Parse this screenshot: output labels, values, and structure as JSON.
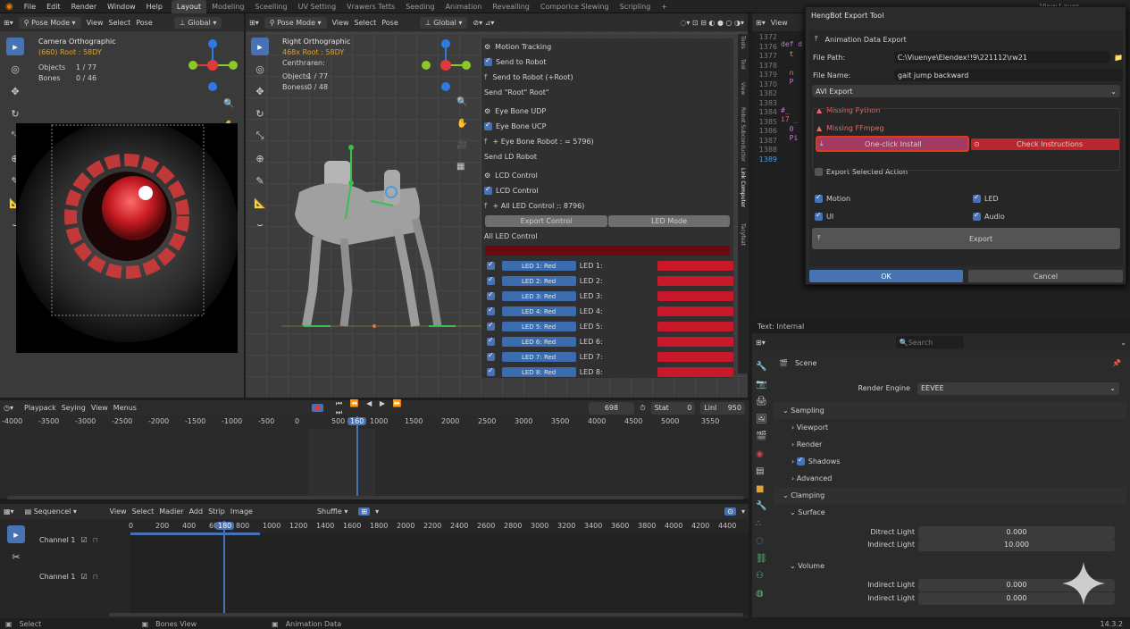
{
  "menu": [
    "File",
    "Edit",
    "Render",
    "Window",
    "Help"
  ],
  "workspaces": [
    "Layout",
    "Modeling",
    "Sceelling",
    "UV Setting",
    "Vrawers Tetts",
    "Seeding",
    "Animation",
    "Revealling",
    "Comporice Slewing",
    "Scripling"
  ],
  "topright": {
    "view_layer": "View Layer"
  },
  "viewport_left": {
    "mode": "Pose Mode",
    "menus": [
      "View",
      "Select",
      "Pose"
    ],
    "transform": "Global",
    "title": "Camera Orthographic",
    "subtitle": "(660) Root : 58DY",
    "objects_label": "Objects",
    "objects_value": "1 / 77",
    "bones_label": "Bones",
    "bones_value": "0 / 46"
  },
  "viewport_right": {
    "mode": "Pose Mode",
    "menus": [
      "View",
      "Select",
      "Pose"
    ],
    "transform": "Global",
    "title": "Right Orthographic",
    "subtitle": "468x Root : 58DY",
    "name": "Centhraren:",
    "objects_label": "Objects",
    "objects_value": "1 / 77",
    "bones_label": "Boness",
    "bones_value": "0 / 48"
  },
  "npanel": {
    "items": [
      {
        "label": "Motion Tracking",
        "type": "header"
      },
      {
        "label": "Send to Robot",
        "type": "check"
      },
      {
        "label": "Send to Robot (+Root)",
        "type": "arrow"
      },
      {
        "label": "Send \"Root\" Root\"",
        "type": "plain"
      },
      {
        "label": "Eye Bone UDP",
        "type": "header"
      },
      {
        "label": "Eye Bone UCP",
        "type": "check"
      },
      {
        "label": "+ Eye Bone Robot : = 5796)",
        "type": "arrow"
      },
      {
        "label": "Send LD Robot",
        "type": "plain"
      },
      {
        "label": "LCD Control",
        "type": "header"
      },
      {
        "label": "LCD Control",
        "type": "check"
      },
      {
        "label": "+ All LED Control :: 8796)",
        "type": "arrow"
      }
    ],
    "export_control": "Export Control",
    "led_mode": "LED Mode",
    "all_led": "All LED Control",
    "leds": [
      {
        "btn": "LED 1: Red",
        "label": "LED 1:"
      },
      {
        "btn": "LED 2: Red",
        "label": "LED 2:"
      },
      {
        "btn": "LED 3: Red",
        "label": "LED 3:"
      },
      {
        "btn": "LED 4: Red",
        "label": "LED 4:"
      },
      {
        "btn": "LED 5: Red",
        "label": "LED 5:"
      },
      {
        "btn": "LED 6: Red",
        "label": "LED 6:"
      },
      {
        "btn": "LED 7: Red",
        "label": "LED 7:"
      },
      {
        "btn": "LED 8: Red",
        "label": "LED 8:"
      }
    ],
    "tabs": [
      "Tools",
      "Tool",
      "View",
      "Robot Subconductor",
      "Link Computer",
      "Tacyfeat"
    ]
  },
  "code": {
    "view": "View",
    "lines": [
      "1372",
      "1376",
      "1377",
      "1378",
      "1379",
      "1370",
      "1382",
      "1383",
      "1384",
      "1385",
      "1386",
      "1387",
      "1388",
      "1389"
    ]
  },
  "dialog": {
    "title": "HengBot Export Tool",
    "section": "Animation Data Export",
    "file_path_label": "File Path:",
    "file_path": "C:\\Viuenye\\Elendex!!9\\221112\\rw21",
    "file_name_label": "File Name:",
    "file_name": "gait jump backward",
    "format": "AVI Export",
    "warn1": "Missing Python",
    "warn2": "Missing FFmpeg",
    "install": "One-click Install",
    "instructions": "Check Instructions",
    "export_selected": "Export Selected Action",
    "opt_motion": "Motion",
    "opt_led": "LED",
    "opt_ui": "UI",
    "opt_audio": "Audio",
    "export": "Export",
    "ok": "OK",
    "cancel": "Cancel"
  },
  "text_internal": "Text: Internal",
  "properties": {
    "search": "Search",
    "scene": "Scene",
    "render_engine_label": "Render Engine",
    "render_engine": "EEVEE",
    "sampling": "Sampling",
    "viewport": "Viewport",
    "render": "Render",
    "shadows": "Shadows",
    "advanced": "Advanced",
    "clamping": "Clamping",
    "surface": "Surface",
    "direct_label": "Ditrect Light",
    "direct_value": "0.000",
    "indirect_label": "Indirect Light",
    "indirect_value": "10.000",
    "volume": "Volume",
    "vol_ind1_label": "Indirect Light",
    "vol_ind1_value": "0.000",
    "vol_ind2_label": "Indirect Light",
    "vol_ind2_value": "0.000"
  },
  "timeline": {
    "menus": [
      "Playpack",
      "Seying",
      "View",
      "Menus"
    ],
    "frame": "698",
    "stat_label": "Stat",
    "stat_value": "0",
    "end_label": "Linl",
    "end_value": "950",
    "current": "160",
    "ticks": [
      "-4000",
      "-3500",
      "-3000",
      "-2500",
      "-2000",
      "-1500",
      "-1000",
      "-500",
      "0",
      "500",
      "1000",
      "1500",
      "2000",
      "2500",
      "3000",
      "3500",
      "4000",
      "4500",
      "5000",
      "3550"
    ]
  },
  "sequencer": {
    "title": "Sequencel",
    "menus": [
      "View",
      "Select",
      "Madier",
      "Add",
      "Strip",
      "Image"
    ],
    "shuffle": "Shuffle",
    "current": "180",
    "ticks": [
      "0",
      "200",
      "400",
      "600",
      "800",
      "1000",
      "1200",
      "1400",
      "1600",
      "1800",
      "2000",
      "2200",
      "2400",
      "2600",
      "2800",
      "3000",
      "3200",
      "3400",
      "3600",
      "3800",
      "4000",
      "4200",
      "4400"
    ],
    "channels": [
      "Channel 1",
      "Channel 1"
    ]
  },
  "status": {
    "select": "Select",
    "bones": "Bones View",
    "anim": "Animation Data",
    "version": "14.3.2"
  },
  "colors": {
    "accent": "#4772b3",
    "led_red": "#c8182a",
    "highlight": "#e03a1c"
  }
}
